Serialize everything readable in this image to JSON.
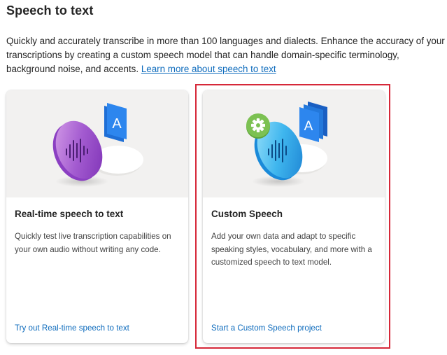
{
  "page": {
    "title": "Speech to text",
    "intro": "Quickly and accurately transcribe in more than 100 languages and dialects. Enhance the accuracy of your transcriptions by creating a custom speech model that can handle domain-specific terminology, background noise, and accents.",
    "learn_more_link": "Learn more about speech to text"
  },
  "cards": [
    {
      "title": "Real-time speech to text",
      "description": "Quickly test live transcription capabilities on your own audio without writing any code.",
      "link": "Try out Real-time speech to text",
      "icon": "purple-voice-disc-icon"
    },
    {
      "title": "Custom Speech",
      "description": "Add your own data and adapt to specific speaking styles, vocabulary, and more with a customized speech to text model.",
      "link": "Start a Custom Speech project",
      "icon": "blue-voice-disc-gear-icon"
    }
  ],
  "colors": {
    "link": "#0f6cbd",
    "highlight": "#d62839",
    "hero_bg": "#f2f1f0"
  }
}
